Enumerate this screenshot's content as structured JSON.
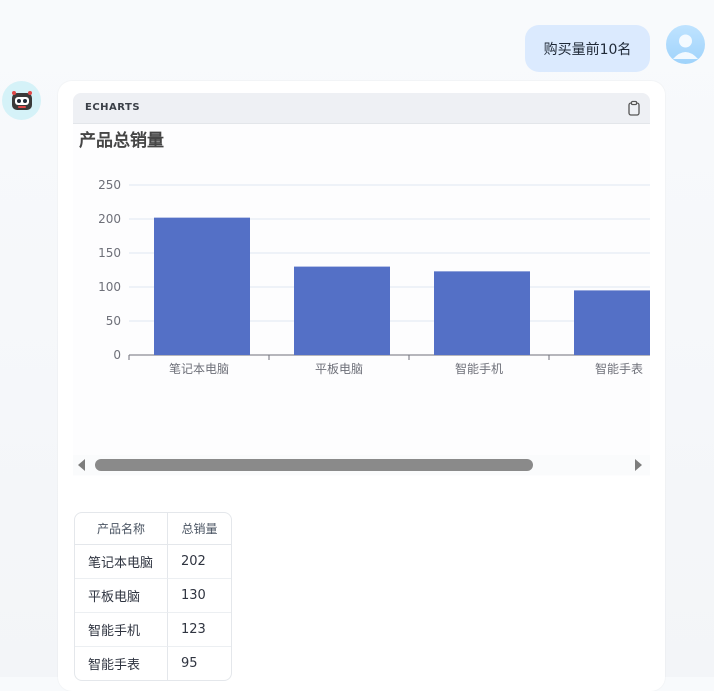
{
  "user_message": "购买量前10名",
  "code_block": {
    "language": "ECHARTS"
  },
  "chart_data": {
    "type": "bar",
    "title": "产品总销量",
    "categories": [
      "笔记本电脑",
      "平板电脑",
      "智能手机",
      "智能手表"
    ],
    "values": [
      202,
      130,
      123,
      95
    ],
    "ylim": [
      0,
      250
    ],
    "yticks": [
      0,
      50,
      100,
      150,
      200,
      250
    ],
    "grid": true,
    "color": "#5470c6"
  },
  "table": {
    "headers": [
      "产品名称",
      "总销量"
    ],
    "rows": [
      [
        "笔记本电脑",
        "202"
      ],
      [
        "平板电脑",
        "130"
      ],
      [
        "智能手机",
        "123"
      ],
      [
        "智能手表",
        "95"
      ]
    ]
  },
  "icons": {
    "copy": "clipboard-icon",
    "user": "user-avatar-icon",
    "bot": "robot-icon"
  }
}
